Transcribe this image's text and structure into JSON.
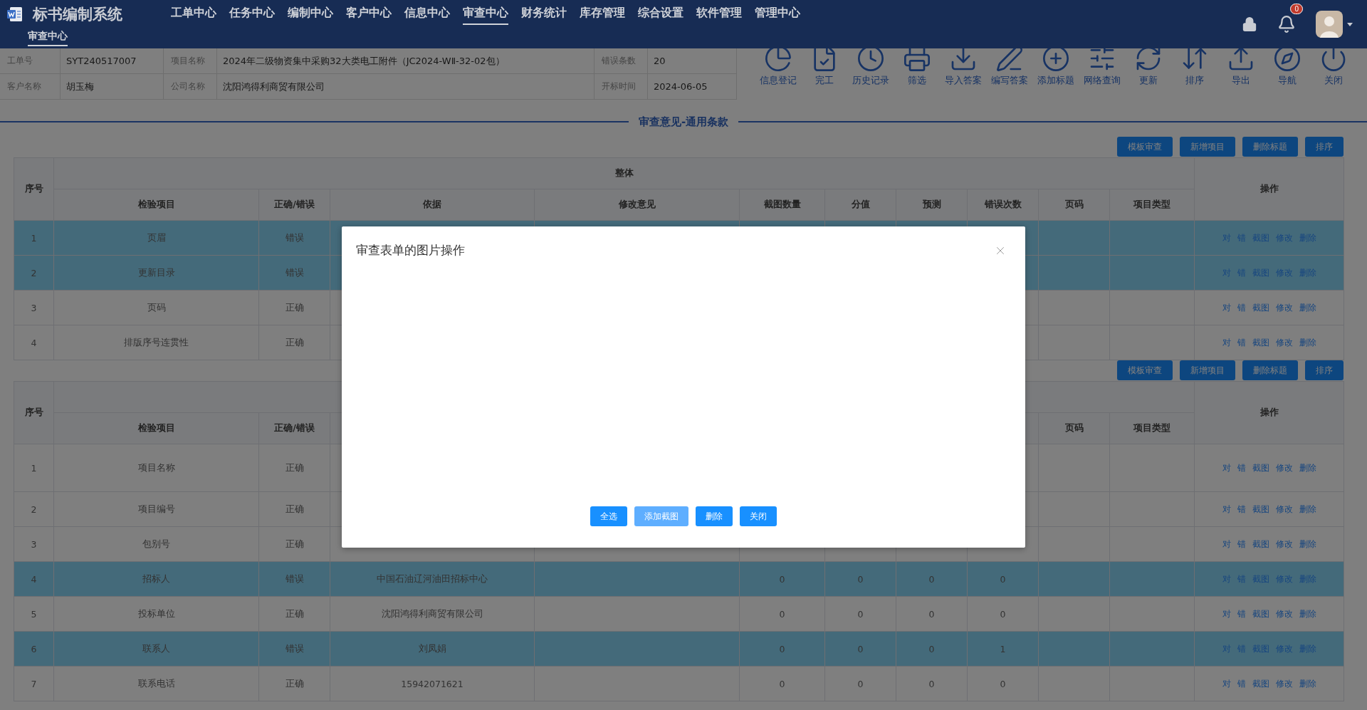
{
  "header": {
    "app_title": "标书编制系统",
    "nav": [
      {
        "label": "工单中心",
        "selected": false
      },
      {
        "label": "任务中心",
        "selected": false
      },
      {
        "label": "编制中心",
        "selected": false
      },
      {
        "label": "客户中心",
        "selected": false
      },
      {
        "label": "信息中心",
        "selected": false
      },
      {
        "label": "审查中心",
        "selected": true
      },
      {
        "label": "财务统计",
        "selected": false
      },
      {
        "label": "库存管理",
        "selected": false
      },
      {
        "label": "综合设置",
        "selected": false
      },
      {
        "label": "软件管理",
        "selected": false
      },
      {
        "label": "管理中心",
        "selected": false
      }
    ],
    "sub_tabs": [
      {
        "label": "审查中心",
        "selected": true
      }
    ],
    "notification_count": "0"
  },
  "info": [
    [
      {
        "label": "工单号",
        "value": "SYT240517007"
      },
      {
        "label": "项目名称",
        "value": "2024年二级物资集中采购32大类电工附件（JC2024-WⅡ-32-02包）"
      },
      {
        "label": "错误条数",
        "value": "20"
      }
    ],
    [
      {
        "label": "客户名称",
        "value": "胡玉梅"
      },
      {
        "label": "公司名称",
        "value": "沈阳鸿得利商贸有限公司"
      },
      {
        "label": "开标时间",
        "value": "2024-06-05"
      }
    ]
  ],
  "toolbar": [
    "信息登记",
    "完工",
    "历史记录",
    "筛选",
    "导入答案",
    "编写答案",
    "添加标题",
    "网络查询",
    "更新",
    "排序",
    "导出",
    "导航",
    "关闭"
  ],
  "section_title": "审查意见-通用条款",
  "tables": [
    {
      "buttons": [
        "模板审查",
        "新增项目",
        "删除标题",
        "排序"
      ],
      "no_header": "序号",
      "group_header": "整体",
      "ops_header": "操作",
      "columns": {
        "item": "检验项目",
        "result": "正确/错误",
        "basis": "依据",
        "advice": "修改意见",
        "shots": "截图数量",
        "score": "分值",
        "forecast": "预测",
        "errors": "错误次数",
        "page": "页码",
        "type": "项目类型"
      },
      "rows": [
        {
          "no": "1",
          "selected": true,
          "cells": {
            "item": "页眉",
            "result": "错误"
          },
          "actions": [
            "对",
            "错",
            "截图",
            "修改",
            "删除"
          ]
        },
        {
          "no": "2",
          "selected": true,
          "cells": {
            "item": "更新目录",
            "result": "错误"
          },
          "actions": [
            "对",
            "错",
            "截图",
            "修改",
            "删除"
          ]
        },
        {
          "no": "3",
          "selected": false,
          "cells": {
            "item": "页码",
            "result": "正确"
          },
          "actions": [
            "对",
            "错",
            "截图",
            "修改",
            "删除"
          ]
        },
        {
          "no": "4",
          "selected": false,
          "cells": {
            "item": "排版序号连贯性",
            "result": "正确"
          },
          "actions": [
            "对",
            "错",
            "截图",
            "修改",
            "删除"
          ]
        }
      ]
    },
    {
      "buttons": [
        "模板审查",
        "新增项目",
        "删除标题",
        "排序"
      ],
      "no_header": "序号",
      "ops_header": "操作",
      "columns": {
        "item": "检验项目",
        "result": "正确/错误",
        "page": "页码",
        "type": "项目类型"
      },
      "rows": [
        {
          "no": "1",
          "selected": false,
          "tall": true,
          "cells": {
            "item": "项目名称",
            "result": "正确"
          },
          "actions": [
            "对",
            "错",
            "截图",
            "修改",
            "删除"
          ]
        },
        {
          "no": "2",
          "selected": false,
          "cells": {
            "item": "项目编号",
            "result": "正确"
          },
          "actions": [
            "对",
            "错",
            "截图",
            "修改",
            "删除"
          ]
        },
        {
          "no": "3",
          "selected": false,
          "cells": {
            "item": "包别号",
            "result": "正确"
          },
          "actions": [
            "对",
            "错",
            "截图",
            "修改",
            "删除"
          ]
        },
        {
          "no": "4",
          "selected": true,
          "cells": {
            "item": "招标人",
            "result": "错误",
            "basis": "中国石油辽河油田招标中心",
            "shots": "0",
            "score": "0",
            "forecast": "0",
            "errors": "0"
          },
          "actions": [
            "对",
            "错",
            "截图",
            "修改",
            "删除"
          ]
        },
        {
          "no": "5",
          "selected": false,
          "cells": {
            "item": "投标单位",
            "result": "正确",
            "basis": "沈阳鸿得利商贸有限公司",
            "shots": "0",
            "score": "0",
            "forecast": "0",
            "errors": "0"
          },
          "actions": [
            "对",
            "错",
            "截图",
            "修改",
            "删除"
          ]
        },
        {
          "no": "6",
          "selected": true,
          "cells": {
            "item": "联系人",
            "result": "错误",
            "basis": "刘凤娟",
            "shots": "0",
            "score": "0",
            "forecast": "0",
            "errors": "1"
          },
          "actions": [
            "对",
            "错",
            "截图",
            "修改",
            "删除"
          ]
        },
        {
          "no": "7",
          "selected": false,
          "cells": {
            "item": "联系电话",
            "result": "正确",
            "basis": "15942071621",
            "shots": "0",
            "score": "0",
            "forecast": "0",
            "errors": "0"
          },
          "actions": [
            "对",
            "错",
            "截图",
            "修改",
            "删除"
          ]
        }
      ]
    }
  ],
  "modal": {
    "title": "审查表单的图片操作",
    "buttons": [
      {
        "label": "全选",
        "disabled": false
      },
      {
        "label": "添加截图",
        "disabled": true
      },
      {
        "label": "删除",
        "disabled": false
      },
      {
        "label": "关闭",
        "disabled": false
      }
    ]
  }
}
